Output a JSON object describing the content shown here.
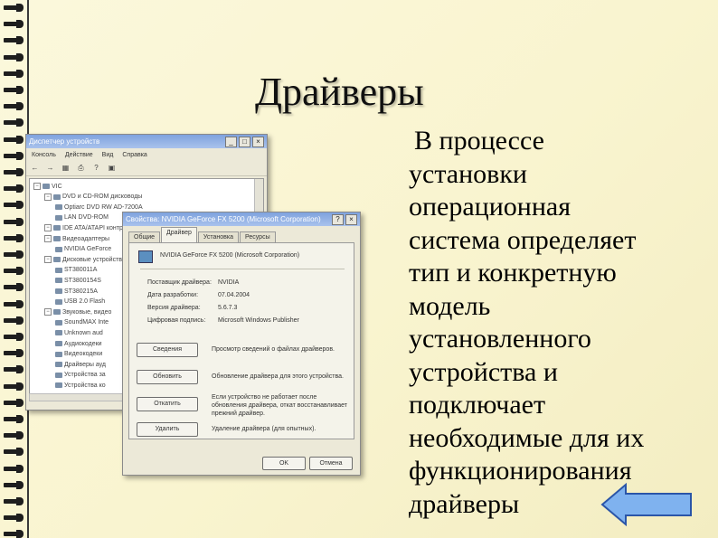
{
  "slide": {
    "title": "Драйверы",
    "body_lines": [
      "В процессе",
      "установки",
      "операционная",
      "система определяет",
      "тип и конкретную",
      "модель",
      "установленного",
      "устройства и",
      "подключает",
      "необходимые для их",
      "функционирования",
      "драйверы"
    ]
  },
  "device_manager": {
    "title": "Диспетчер устройств",
    "menu": [
      "Консоль",
      "Действие",
      "Вид",
      "Справка"
    ],
    "tree": [
      "VIC",
      "DVD и CD-ROM дисководы",
      "Optiarc DVD RW AD-7200A",
      "LAN DVD-ROM",
      "IDE ATA/ATAPI контроллеры",
      "Видеоадаптеры",
      "NVIDIA GeForce",
      "Дисковые устройства",
      "ST380011A",
      "ST3800154S",
      "ST380215A",
      "USB 2.0 Flash",
      "Звуковые, видео",
      "SoundMAX Inte",
      "Unknown aud",
      "Аудиокодеки",
      "Видеокодеки",
      "Драйверы ауд",
      "Устройства за",
      "Устройства ко"
    ]
  },
  "properties": {
    "title": "Свойства: NVIDIA GeForce FX 5200 (Microsoft Corporation)",
    "tabs": [
      "Общие",
      "Драйвер",
      "Установка",
      "Ресурсы"
    ],
    "device": "NVIDIA GeForce FX 5200 (Microsoft Corporation)",
    "fields": [
      {
        "key": "Поставщик драйвера:",
        "value": "NVIDIA"
      },
      {
        "key": "Дата разработки:",
        "value": "07.04.2004"
      },
      {
        "key": "Версия драйвера:",
        "value": "5.6.7.3"
      },
      {
        "key": "Цифровая подпись:",
        "value": "Microsoft Windows Publisher"
      }
    ],
    "buttons": [
      {
        "label": "Сведения",
        "desc": "Просмотр сведений о файлах драйверов."
      },
      {
        "label": "Обновить",
        "desc": "Обновление драйвера для этого устройства."
      },
      {
        "label": "Откатить",
        "desc": "Если устройство не работает после обновления драйвера, откат восстанавливает прежний драйвер."
      },
      {
        "label": "Удалить",
        "desc": "Удаление драйвера (для опытных)."
      }
    ],
    "ok": "OK",
    "cancel": "Отмена"
  },
  "icons": [
    "minimize-icon",
    "maximize-icon",
    "close-icon",
    "help-icon",
    "back-icon",
    "forward-icon",
    "print-icon",
    "device-icon",
    "nav-arrow-left-icon"
  ],
  "colors": {
    "nav_arrow_fill": "#7fb2ef",
    "nav_arrow_stroke": "#2a55a8",
    "titlebar": "#8fb0e4"
  }
}
